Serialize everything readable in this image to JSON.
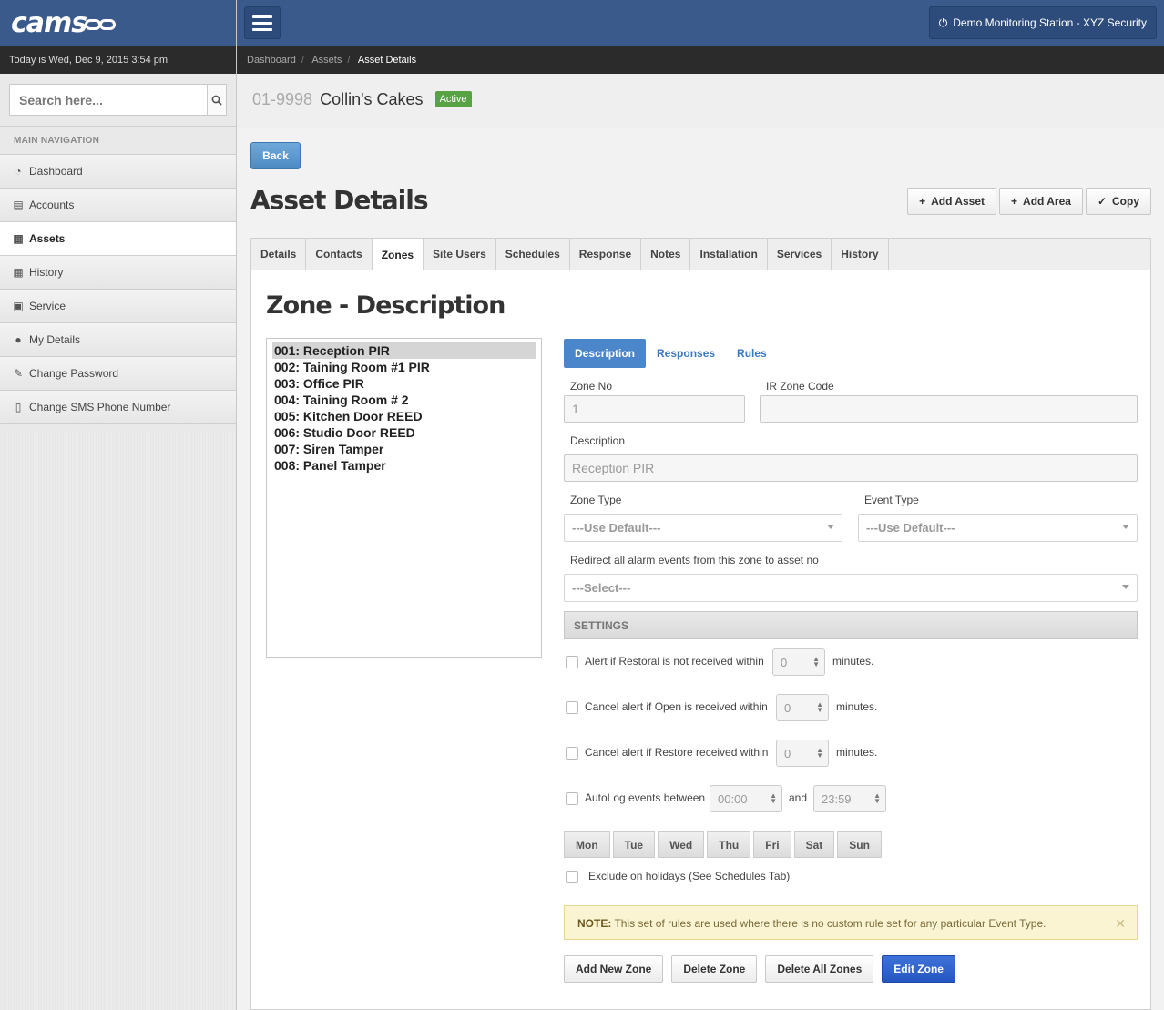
{
  "app": {
    "logo": "cams",
    "station": "Demo Monitoring Station - XYZ Security"
  },
  "sidebar": {
    "date": "Today is Wed, Dec 9, 2015 3:54 pm",
    "search_placeholder": "Search here...",
    "nav_heading": "MAIN NAVIGATION",
    "items": [
      {
        "label": "Dashboard",
        "icon": "dashboard-icon",
        "glyph": "◔"
      },
      {
        "label": "Accounts",
        "icon": "book-icon",
        "glyph": "▤"
      },
      {
        "label": "Assets",
        "icon": "building-icon",
        "glyph": "▦",
        "active": true
      },
      {
        "label": "History",
        "icon": "calendar-icon",
        "glyph": "▦"
      },
      {
        "label": "Service",
        "icon": "medkit-icon",
        "glyph": "▣"
      },
      {
        "label": "My Details",
        "icon": "user-icon",
        "glyph": "●"
      },
      {
        "label": "Change Password",
        "icon": "edit-icon",
        "glyph": "✎"
      },
      {
        "label": "Change SMS Phone Number",
        "icon": "mobile-icon",
        "glyph": "▯"
      }
    ]
  },
  "breadcrumb": [
    "Dashboard",
    "Assets",
    "Asset Details"
  ],
  "asset": {
    "number": "01-9998",
    "name": "Collin's Cakes",
    "status": "Active"
  },
  "page": {
    "back": "Back",
    "title": "Asset Details",
    "actions": [
      {
        "label": "Add Asset",
        "icon": "plus-icon",
        "glyph": "+"
      },
      {
        "label": "Add Area",
        "icon": "plus-icon",
        "glyph": "+"
      },
      {
        "label": "Copy",
        "icon": "check-circle-icon",
        "glyph": "✓"
      }
    ]
  },
  "tabs": [
    "Details",
    "Contacts",
    "Zones",
    "Site Users",
    "Schedules",
    "Response",
    "Notes",
    "Installation",
    "Services",
    "History"
  ],
  "active_tab": "Zones",
  "zone": {
    "heading": "Zone - Description",
    "list": [
      "001: Reception PIR",
      "002: Taining Room #1 PIR",
      "003: Office PIR",
      "004: Taining Room # 2",
      "005: Kitchen Door REED",
      "006: Studio Door REED",
      "007: Siren Tamper",
      "008: Panel Tamper"
    ],
    "subtabs": [
      "Description",
      "Responses",
      "Rules"
    ],
    "form": {
      "zone_no_label": "Zone No",
      "zone_no_value": "1",
      "ir_label": "IR Zone Code",
      "ir_value": "",
      "desc_label": "Description",
      "desc_value": "Reception PIR",
      "zone_type_label": "Zone Type",
      "zone_type_value": "---Use Default---",
      "event_type_label": "Event Type",
      "event_type_value": "---Use Default---",
      "redirect_label": "Redirect all alarm events from this zone to asset no",
      "redirect_value": "---Select---"
    },
    "settings": {
      "heading": "SETTINGS",
      "restoral_label": "Alert if Restoral is not received within",
      "restoral_value": "0",
      "open_label": "Cancel alert if Open is received within",
      "open_value": "0",
      "restore_label": "Cancel alert if Restore received within",
      "restore_value": "0",
      "minutes": "minutes.",
      "autolog_label": "AutoLog events between",
      "autolog_from": "00:00",
      "and": "and",
      "autolog_to": "23:59",
      "days": [
        "Mon",
        "Tue",
        "Wed",
        "Thu",
        "Fri",
        "Sat",
        "Sun"
      ],
      "holidays_label": "Exclude on holidays (See Schedules Tab)"
    },
    "note": {
      "prefix": "NOTE:",
      "text": " This set of rules are used where there is no custom rule set for any particular Event Type."
    },
    "buttons": [
      "Add New Zone",
      "Delete Zone",
      "Delete All Zones",
      "Edit Zone"
    ]
  }
}
